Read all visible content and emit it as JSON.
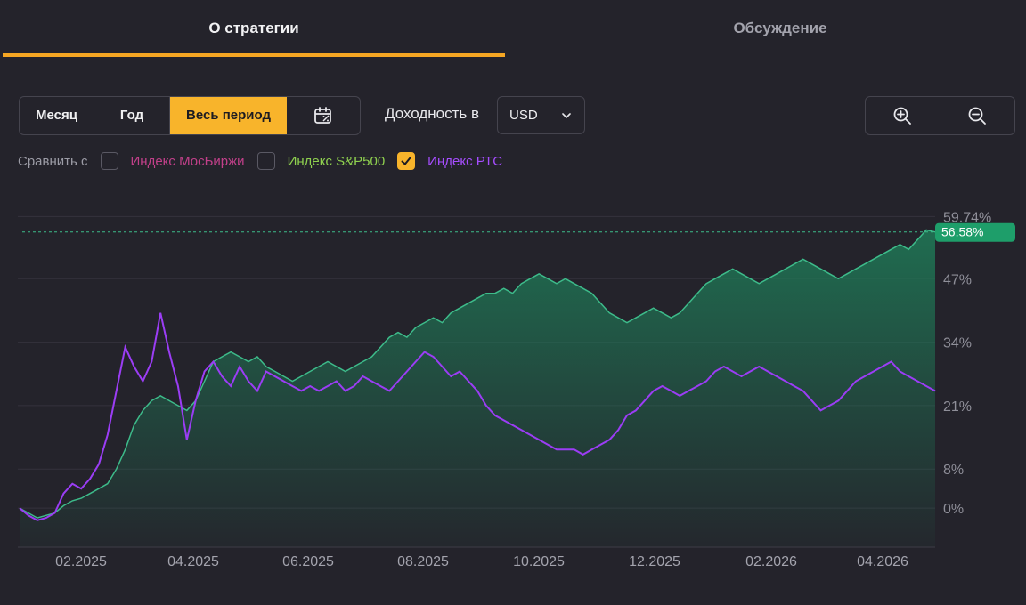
{
  "tabs": [
    {
      "label": "О стратегии",
      "active": true
    },
    {
      "label": "Обсуждение",
      "active": false
    }
  ],
  "toolbar": {
    "period_buttons": [
      "Месяц",
      "Год",
      "Весь период"
    ],
    "selected_period": "Весь период",
    "calendar_icon": "calendar-icon",
    "yield_label": "Доходность в",
    "currency": "USD",
    "zoom_in_icon": "zoom-in-icon",
    "zoom_out_icon": "zoom-out-icon"
  },
  "compare": {
    "label": "Сравнить с",
    "items": [
      {
        "label": "Индекс МосБиржи",
        "checked": false,
        "color": "#c2408a"
      },
      {
        "label": "Индекс S&P500",
        "checked": false,
        "color": "#8fd14f"
      },
      {
        "label": "Индекс РТС",
        "checked": true,
        "color": "#a64dff"
      }
    ]
  },
  "colors": {
    "accent": "#f8b42b",
    "strategy_line": "#3dbb8a",
    "strategy_fill": "#1f7a57",
    "rts_line": "#9b3df5",
    "badge": "#1e9e6a"
  },
  "chart_data": {
    "type": "area",
    "x_ticks": [
      "02.2025",
      "04.2025",
      "06.2025",
      "08.2025",
      "10.2025",
      "12.2025",
      "02.2026",
      "04.2026"
    ],
    "y_ticks": [
      "59.74%",
      "47%",
      "34%",
      "21%",
      "8%",
      "0%"
    ],
    "y_tick_values": [
      59.74,
      47,
      34,
      21,
      8,
      0
    ],
    "ylim": [
      -8,
      64
    ],
    "current_value_label": "56.58%",
    "current_value": 56.58,
    "grid": true,
    "series": [
      {
        "name": "strategy",
        "values": [
          0,
          -1,
          -2,
          -1.5,
          -1,
          0.5,
          1.5,
          2,
          3,
          4,
          5,
          8,
          12,
          17,
          20,
          22,
          23,
          22,
          21,
          20,
          22,
          26,
          30,
          31,
          32,
          31,
          30,
          31,
          29,
          28,
          27,
          26,
          27,
          28,
          29,
          30,
          29,
          28,
          29,
          30,
          31,
          33,
          35,
          36,
          35,
          37,
          38,
          39,
          38,
          40,
          41,
          42,
          43,
          44,
          44,
          45,
          44,
          46,
          47,
          48,
          47,
          46,
          47,
          46,
          45,
          44,
          42,
          40,
          39,
          38,
          39,
          40,
          41,
          40,
          39,
          40,
          42,
          44,
          46,
          47,
          48,
          49,
          48,
          47,
          46,
          47,
          48,
          49,
          50,
          51,
          50,
          49,
          48,
          47,
          48,
          49,
          50,
          51,
          52,
          53,
          54,
          53,
          55,
          57,
          56.58
        ]
      },
      {
        "name": "Индекс РТС",
        "values": [
          0,
          -1.5,
          -2.5,
          -2,
          -1,
          3,
          5,
          4,
          6,
          9,
          15,
          24,
          33,
          29,
          26,
          30,
          40,
          32,
          25,
          14,
          22,
          28,
          30,
          27,
          25,
          29,
          26,
          24,
          28,
          27,
          26,
          25,
          24,
          25,
          24,
          25,
          26,
          24,
          25,
          27,
          26,
          25,
          24,
          26,
          28,
          30,
          32,
          31,
          29,
          27,
          28,
          26,
          24,
          21,
          19,
          18,
          17,
          16,
          15,
          14,
          13,
          12,
          12,
          12,
          11,
          12,
          13,
          14,
          16,
          19,
          20,
          22,
          24,
          25,
          24,
          23,
          24,
          25,
          26,
          28,
          29,
          28,
          27,
          28,
          29,
          28,
          27,
          26,
          25,
          24,
          22,
          20,
          21,
          22,
          24,
          26,
          27,
          28,
          29,
          30,
          28,
          27,
          26,
          25,
          24
        ]
      }
    ]
  }
}
